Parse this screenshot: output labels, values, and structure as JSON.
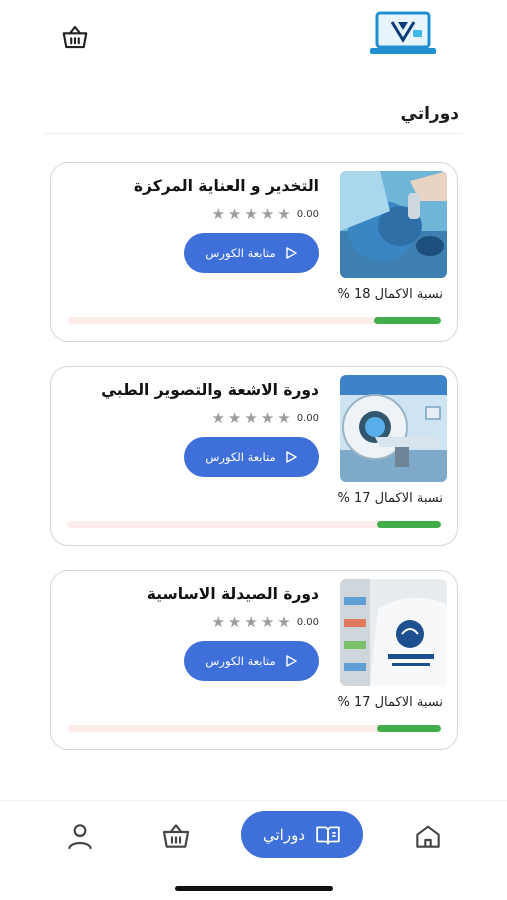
{
  "header": {
    "cart_icon": "basket-icon",
    "logo_icon": "laptop-logo-icon"
  },
  "section": {
    "title": "دوراتي"
  },
  "courses": [
    {
      "title": "التخدير و العناية المركزة",
      "rating": "0.00",
      "button_label": "متابعة الكورس",
      "progress_label": "نسبة الاكمال 18 %",
      "progress": 0.18,
      "image_icon": "anesthesia-image"
    },
    {
      "title": "دورة الاشعة والتصوير الطبي",
      "rating": "0.00",
      "button_label": "متابعة الكورس",
      "progress_label": "نسبة الاكمال 17 %",
      "progress": 0.17,
      "image_icon": "mri-scanner-image"
    },
    {
      "title": "دورة الصيدلة الاساسية",
      "rating": "0.00",
      "button_label": "متابعة الكورس",
      "progress_label": "نسبة الاكمال 17 %",
      "progress": 0.17,
      "image_icon": "pharmacy-image"
    }
  ],
  "bottom_nav": {
    "profile_icon": "user-icon",
    "cart_icon": "basket-icon",
    "active_label": "دوراتي",
    "active_icon": "book-icon",
    "home_icon": "home-icon"
  },
  "colors": {
    "accent": "#3f6fd8",
    "progress": "#43ad4b",
    "track": "#fdecec",
    "star": "#9c9c9c"
  }
}
